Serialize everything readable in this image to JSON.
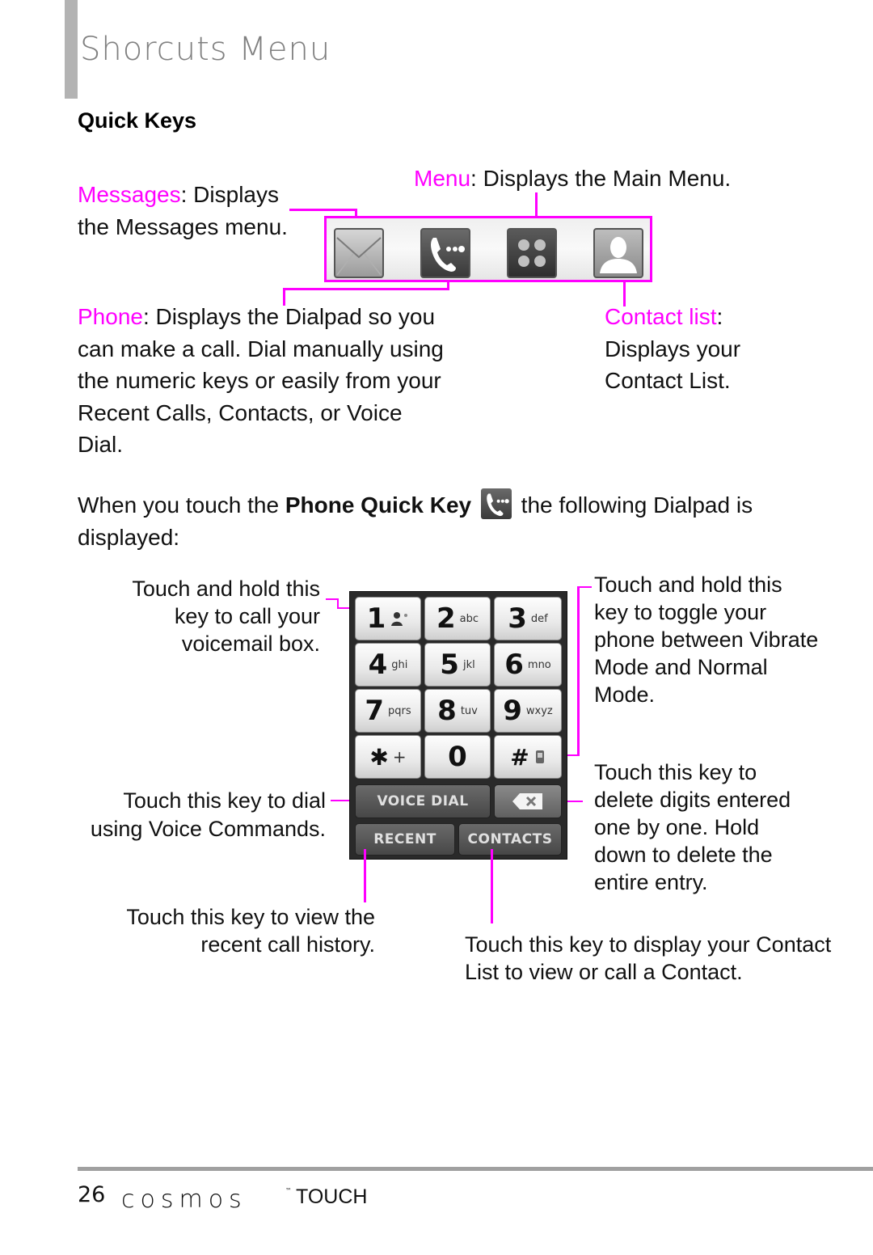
{
  "page": {
    "title": "Shorcuts Menu",
    "section_heading": "Quick Keys"
  },
  "quick_keys": {
    "messages": {
      "label": "Messages",
      "desc": ": Displays",
      "desc2": "the Messages menu.",
      "icon": "envelope-icon"
    },
    "menu": {
      "label": "Menu",
      "desc": ": Displays the Main Menu.",
      "icon": "grid-icon"
    },
    "phone": {
      "label": "Phone",
      "desc": ": Displays the Dialpad so you",
      "lines": [
        "can make a call. Dial manually using",
        "the numeric keys or easily from your",
        "Recent Calls, Contacts, or Voice",
        "Dial."
      ],
      "icon": "phone-icon"
    },
    "contacts": {
      "label": "Contact list",
      "desc": ":",
      "lines": [
        "Displays your",
        "Contact List."
      ],
      "icon": "person-icon"
    }
  },
  "intro": {
    "pre": "When you touch the ",
    "bold": "Phone Quick Key",
    "post": " the following Dialpad is",
    "line2": "displayed:"
  },
  "dialpad": {
    "keys": [
      {
        "num": "1",
        "letters": "voicemail"
      },
      {
        "num": "2",
        "letters": "abc"
      },
      {
        "num": "3",
        "letters": "def"
      },
      {
        "num": "4",
        "letters": "ghi"
      },
      {
        "num": "5",
        "letters": "jkl"
      },
      {
        "num": "6",
        "letters": "mno"
      },
      {
        "num": "7",
        "letters": "pqrs"
      },
      {
        "num": "8",
        "letters": "tuv"
      },
      {
        "num": "9",
        "letters": "wxyz"
      },
      {
        "num": "✱",
        "letters": "+"
      },
      {
        "num": "0",
        "letters": ""
      },
      {
        "num": "#",
        "letters": "vibrate"
      }
    ],
    "voice_dial": "VOICE DIAL",
    "delete": "⌫",
    "recent": "RECENT",
    "contacts": "CONTACTS"
  },
  "callouts": {
    "voicemail": [
      "Touch and hold this",
      "key to call your",
      "voicemail box."
    ],
    "vibrate": [
      "Touch and hold this",
      "key to toggle your",
      "phone between Vibrate",
      "Mode and Normal",
      "Mode."
    ],
    "voice_dial": [
      "Touch this key to dial",
      "using Voice Commands."
    ],
    "delete": [
      "Touch this key to",
      "delete digits entered",
      "one by one. Hold",
      "down to delete the",
      "entire entry."
    ],
    "recent": [
      "Touch this key to view the",
      "recent call history."
    ],
    "contacts": [
      "Touch this key to display your Contact",
      "List to view or call a Contact."
    ]
  },
  "footer": {
    "page_number": "26",
    "brand": "cosmos",
    "trademark": "™",
    "brand_suffix": "TOUCH"
  },
  "colors": {
    "accent": "#ff00ff",
    "title_gray": "#808080",
    "bar_gray": "#b3b3b3"
  }
}
